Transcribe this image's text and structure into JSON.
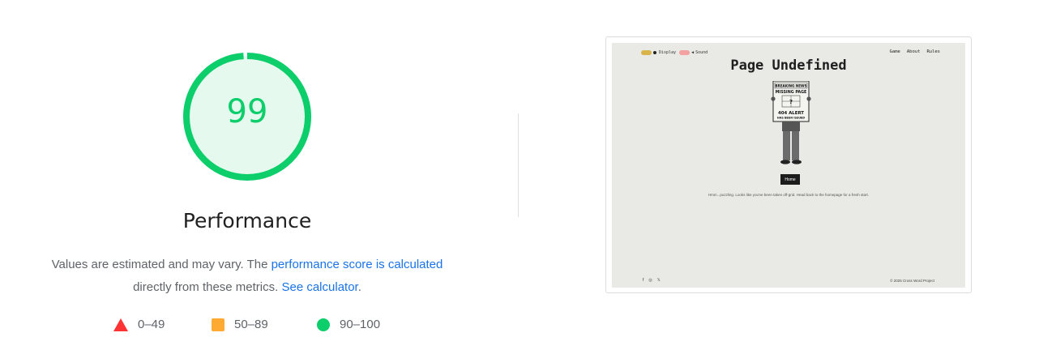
{
  "gauge": {
    "score": "99",
    "score_fraction": 0.99,
    "title": "Performance",
    "color": "#0cce6b"
  },
  "description": {
    "prefix": "Values are estimated and may vary. The ",
    "link1": "performance score is calculated",
    "middle": " directly from these metrics. ",
    "link2": "See calculator",
    "suffix": "."
  },
  "legend": [
    {
      "icon": "red-triangle-icon",
      "label": "0–49",
      "color": "#ff3333"
    },
    {
      "icon": "orange-square-icon",
      "label": "50–89",
      "color": "#ffaa33"
    },
    {
      "icon": "green-circle-icon",
      "label": "90–100",
      "color": "#0cce6b"
    }
  ],
  "screenshot": {
    "toggles": {
      "display": "Display",
      "sound": "Sound"
    },
    "nav": [
      "Game",
      "About",
      "Rules"
    ],
    "title": "Page Undefined",
    "newspaper": {
      "headline1": "BREAKING NEWS",
      "headline2": "MISSING PAGE",
      "alert1": "404 ALERT",
      "alert2": "HAS BEEN ISSUED"
    },
    "home_button": "Home",
    "message": "Hmm...puzzling. Looks like you've been taken off-grid. Head back to the homepage for a fresh start.",
    "social": [
      "f",
      "◎",
      "𝕏"
    ],
    "copyright": "© 2025 Cross Word Project"
  }
}
